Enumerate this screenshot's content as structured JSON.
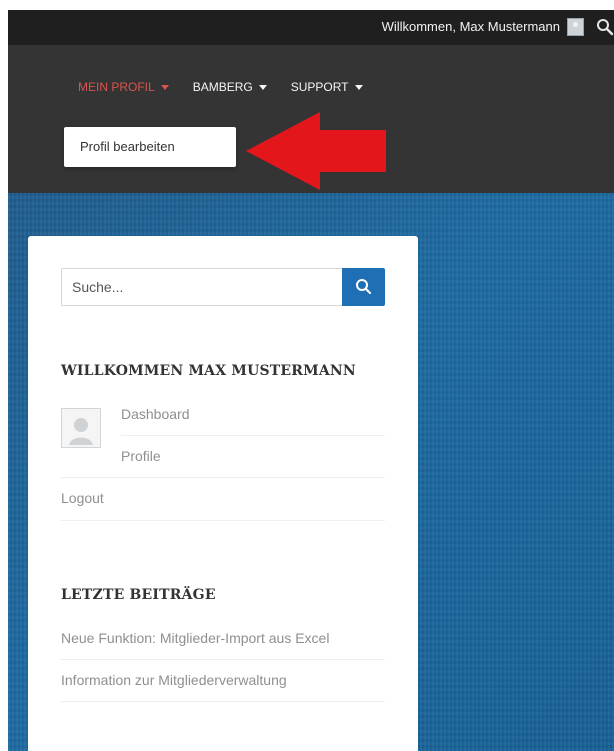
{
  "topbar": {
    "welcome_text": "Willkommen, Max Mustermann",
    "avatar_icon": "user-avatar-icon",
    "search_icon": "search-icon"
  },
  "nav": {
    "items": [
      {
        "label": "MEIN PROFIL",
        "active": true
      },
      {
        "label": "BAMBERG",
        "active": false
      },
      {
        "label": "SUPPORT",
        "active": false
      }
    ],
    "dropdown": {
      "items": [
        {
          "label": "Profil bearbeiten"
        }
      ]
    },
    "annotation_arrow_color": "#e3161c",
    "active_color": "#d9534f"
  },
  "sidebar": {
    "search": {
      "placeholder": "Suche...",
      "button_icon": "search-icon",
      "button_color": "#1f6fb5"
    },
    "welcome_widget": {
      "title": "WILLKOMMEN MAX MUSTERMANN",
      "links": [
        {
          "label": "Dashboard"
        },
        {
          "label": "Profile"
        },
        {
          "label": "Logout"
        }
      ]
    },
    "recent_posts": {
      "title": "LETZTE BEITRÄGE",
      "posts": [
        {
          "label": "Neue Funktion: Mitglieder-Import aus Excel"
        },
        {
          "label": "Information zur Mitgliederverwaltung"
        }
      ]
    }
  }
}
